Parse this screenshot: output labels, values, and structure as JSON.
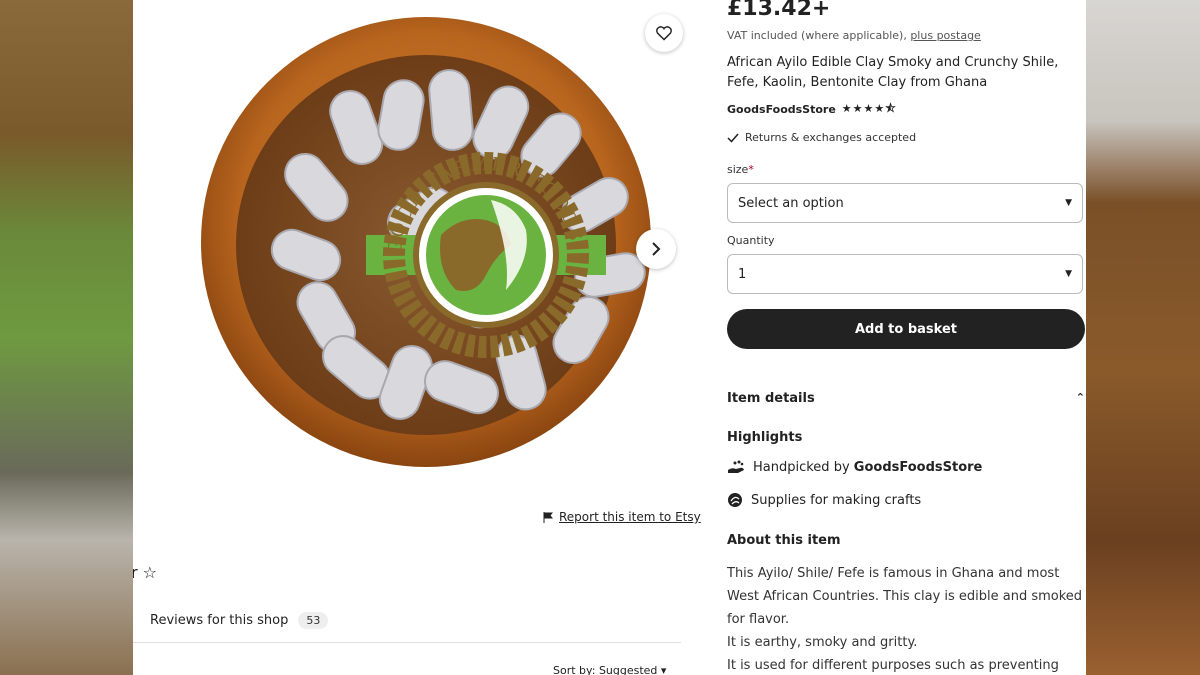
{
  "listing": {
    "price": "£13.42+",
    "vat_text": "VAT included (where applicable),",
    "postage_link": "plus postage",
    "title": "African Ayilo Edible Clay Smoky and Crunchy Shile, Fefe, Kaolin, Bentonite Clay from Ghana",
    "shop_name": "GoodsFoodsStore",
    "shop_stars": "★★★★⯪",
    "returns": "Returns & exchanges accepted",
    "size_label": "size",
    "size_required_mark": "*",
    "size_value": "Select an option",
    "quantity_label": "Quantity",
    "quantity_value": "1",
    "add_button": "Add to basket"
  },
  "details": {
    "item_details": "Item details",
    "highlights": "Highlights",
    "handpicked_prefix": "Handpicked by",
    "handpicked_shop": "GoodsFoodsStore",
    "supplies": "Supplies for making crafts",
    "about_heading": "About this item",
    "about_lines": [
      "This Ayilo/ Shile/ Fefe is famous in Ghana and most",
      "West African Countries. This clay is edible and smoked",
      "for flavor.",
      "It is earthy, smoky and gritty.",
      "It is used for different purposes such as preventing"
    ]
  },
  "gallery": {
    "logo_text": "GOOD FARMER FOODS",
    "report_link": "Report this item to Etsy"
  },
  "reviews": {
    "star_fragment": "r ☆",
    "label": "Reviews for this shop",
    "count": "53",
    "sort": "Sort by: Suggested"
  },
  "icons": {
    "favorite": "heart-icon",
    "next": "chevron-right-icon",
    "flag": "flag-icon",
    "check": "check-icon",
    "hand": "hand-icon",
    "craft": "craft-icon"
  },
  "colors": {
    "bowl": "#b8651e",
    "logo_brown": "#8a6a2a",
    "logo_green": "#6ab340",
    "button_dark": "#222222"
  }
}
